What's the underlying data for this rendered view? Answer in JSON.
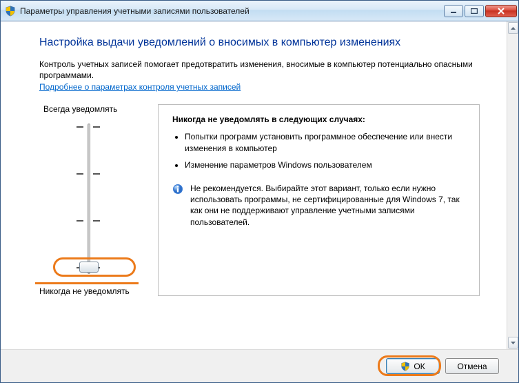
{
  "window": {
    "title": "Параметры управления учетными записями пользователей"
  },
  "page": {
    "heading": "Настройка выдачи уведомлений о вносимых в компьютер изменениях",
    "intro": "Контроль учетных записей помогает предотвратить изменения, вносимые в компьютер потенциально опасными программами.",
    "link": "Подробнее о параметрах контроля учетных записей"
  },
  "slider": {
    "top_label": "Всегда уведомлять",
    "bottom_label": "Никогда не уведомлять",
    "levels": 4,
    "current_level": 0
  },
  "panel": {
    "title": "Никогда не уведомлять в следующих случаях:",
    "bullets": [
      "Попытки программ установить программное обеспечение или внести изменения в компьютер",
      "Изменение параметров Windows пользователем"
    ],
    "info": "Не рекомендуется. Выбирайте этот вариант, только если нужно использовать программы, не сертифицированные для Windows 7, так как они не поддерживают управление учетными записями пользователей."
  },
  "footer": {
    "ok_label": "ОК",
    "cancel_label": "Отмена"
  },
  "icons": {
    "shield": "shield-icon",
    "info": "info-icon"
  }
}
